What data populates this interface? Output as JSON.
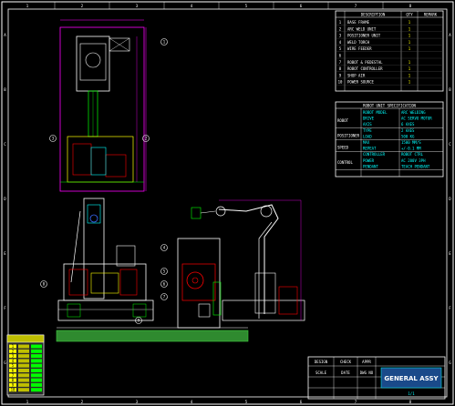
{
  "app": {
    "title": ""
  },
  "colors": {
    "background": "#000000",
    "border": "#ffffff",
    "magenta": "#ff00ff",
    "yellow": "#ffff00",
    "green": "#00ff00",
    "cyan": "#00ffff",
    "red": "#ff0000",
    "blue": "#3a6cff",
    "grass": "#2f8a2f"
  },
  "column_numbers": [
    "1",
    "2",
    "3",
    "4",
    "5",
    "6",
    "7",
    "8"
  ],
  "row_letters": [
    "A",
    "B",
    "C",
    "D",
    "E",
    "F",
    "G"
  ],
  "parts_table": {
    "headers": [
      "",
      "DESCRIPTION",
      "QTY",
      "REMARK"
    ],
    "rows": [
      {
        "no": "1",
        "desc": "BASE FRAME",
        "qty": "1",
        "remark": ""
      },
      {
        "no": "2",
        "desc": "ARC WELD UNIT",
        "qty": "1",
        "remark": ""
      },
      {
        "no": "3",
        "desc": "POSITIONER UNIT",
        "qty": "1",
        "remark": ""
      },
      {
        "no": "4",
        "desc": "WELD TORCH",
        "qty": "1",
        "remark": ""
      },
      {
        "no": "5",
        "desc": "WIRE FEEDER",
        "qty": "1",
        "remark": ""
      },
      {
        "no": "6",
        "desc": "",
        "qty": "",
        "remark": ""
      },
      {
        "no": "7",
        "desc": "ROBOT & PEDESTAL",
        "qty": "1",
        "remark": ""
      },
      {
        "no": "8",
        "desc": "ROBOT CONTROLLER",
        "qty": "1",
        "remark": ""
      },
      {
        "no": "9",
        "desc": "SHOP AIR",
        "qty": "1",
        "remark": ""
      },
      {
        "no": "10",
        "desc": "POWER SOURCE",
        "qty": "1",
        "remark": ""
      }
    ]
  },
  "spec_table": {
    "title": "ROBOT UNIT SPECIFICATION",
    "groups": [
      {
        "label": "ROBOT",
        "rows": [
          [
            "ROBOT MODEL",
            "ARC WELDING"
          ],
          [
            "DRIVE",
            "AC SERVO MOTOR"
          ],
          [
            "AXIS",
            "6 AXES"
          ]
        ]
      },
      {
        "label": "POSITIONER",
        "rows": [
          [
            "TYPE",
            "2 AXES"
          ],
          [
            "LOAD",
            "500 KG"
          ]
        ]
      },
      {
        "label": "SPEED",
        "rows": [
          [
            "MAX",
            "1500 MM/S"
          ],
          [
            "REPEAT",
            "+/-0.1 MM"
          ]
        ]
      },
      {
        "label": "CONTROL",
        "rows": [
          [
            "CONTROLLER",
            "ROBOT CTRL"
          ],
          [
            "POWER",
            "AC 200V 3PH"
          ],
          [
            "PENDANT",
            "TEACH PENDANT"
          ]
        ]
      }
    ]
  },
  "legend_table": {
    "rows": [
      [
        "1",
        "",
        ""
      ],
      [
        "2",
        "",
        ""
      ],
      [
        "3",
        "",
        ""
      ],
      [
        "4",
        "",
        ""
      ],
      [
        "5",
        "",
        ""
      ],
      [
        "6",
        "",
        ""
      ],
      [
        "7",
        "",
        ""
      ],
      [
        "8",
        "",
        ""
      ],
      [
        "9",
        "",
        ""
      ],
      [
        "10",
        "",
        ""
      ]
    ]
  },
  "title_block": {
    "drawing_title": "GENERAL ASSY",
    "labels": [
      "DESIGN",
      "CHECK",
      "APPR",
      "SCALE",
      "DATE",
      "DWG NO"
    ],
    "sheet": "1/1"
  },
  "balloons": [
    "1",
    "2",
    "3",
    "4",
    "5",
    "6",
    "7",
    "8",
    "9"
  ]
}
